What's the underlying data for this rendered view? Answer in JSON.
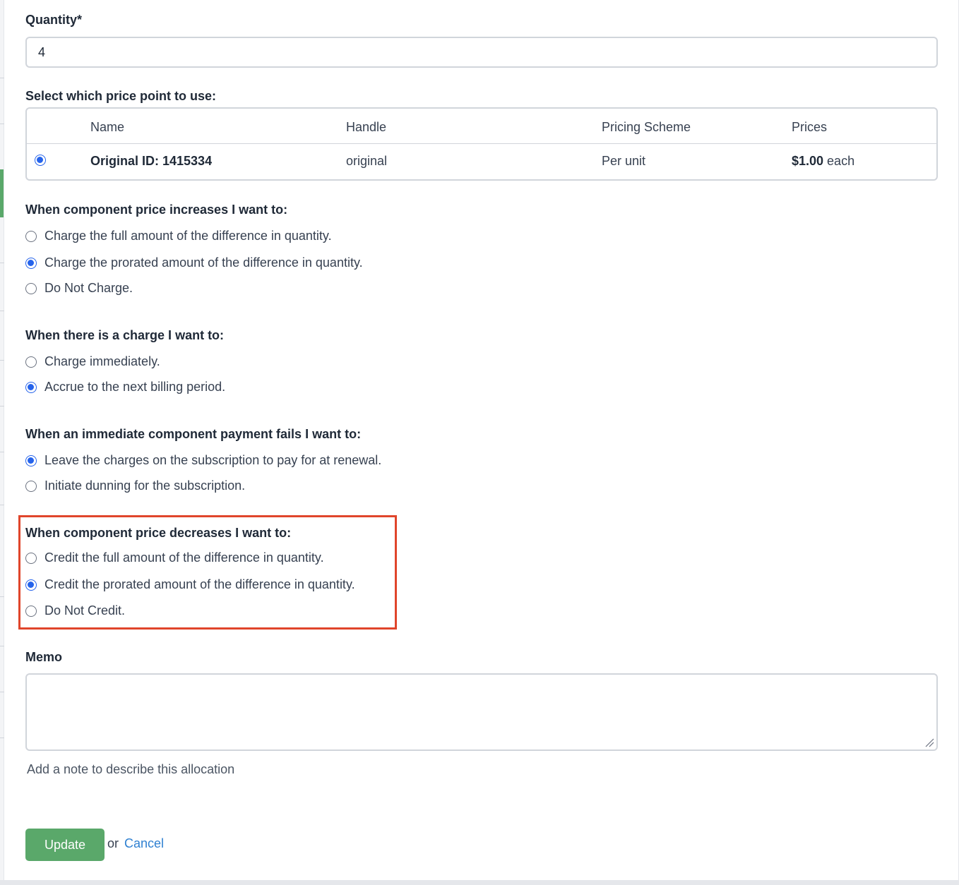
{
  "quantity": {
    "label": "Quantity*",
    "value": "4"
  },
  "price_points": {
    "label": "Select which price point to use:",
    "columns": [
      "Name",
      "Handle",
      "Pricing Scheme",
      "Prices"
    ],
    "rows": [
      {
        "name": "Original ID: 1415334",
        "handle": "original",
        "scheme": "Per unit",
        "price_bold": "$1.00",
        "price_suffix": " each",
        "selected": true
      }
    ]
  },
  "increase": {
    "label": "When component price increases I want to:",
    "options": [
      {
        "text": "Charge the full amount of the difference in quantity.",
        "checked": false
      },
      {
        "text": "Charge the prorated amount of the difference in quantity.",
        "checked": true
      },
      {
        "text": "Do Not Charge.",
        "checked": false
      }
    ]
  },
  "charge": {
    "label": "When there is a charge I want to:",
    "options": [
      {
        "text": "Charge immediately.",
        "checked": false
      },
      {
        "text": "Accrue to the next billing period.",
        "checked": true
      }
    ]
  },
  "payment_fail": {
    "label": "When an immediate component payment fails I want to:",
    "options": [
      {
        "text": "Leave the charges on the subscription to pay for at renewal.",
        "checked": true
      },
      {
        "text": "Initiate dunning for the subscription.",
        "checked": false
      }
    ]
  },
  "decrease": {
    "label": "When component price decreases I want to:",
    "options": [
      {
        "text": "Credit the full amount of the difference in quantity.",
        "checked": false
      },
      {
        "text": "Credit the prorated amount of the difference in quantity.",
        "checked": true
      },
      {
        "text": "Do Not Credit.",
        "checked": false
      }
    ]
  },
  "memo": {
    "label": "Memo",
    "value": "",
    "help": "Add a note to describe this allocation"
  },
  "actions": {
    "update": "Update",
    "or": "or",
    "cancel": "Cancel"
  },
  "colors": {
    "accent": "#2563eb",
    "update_button": "#5aa86a",
    "highlight": "#e0452b",
    "link": "#2f80d1"
  }
}
